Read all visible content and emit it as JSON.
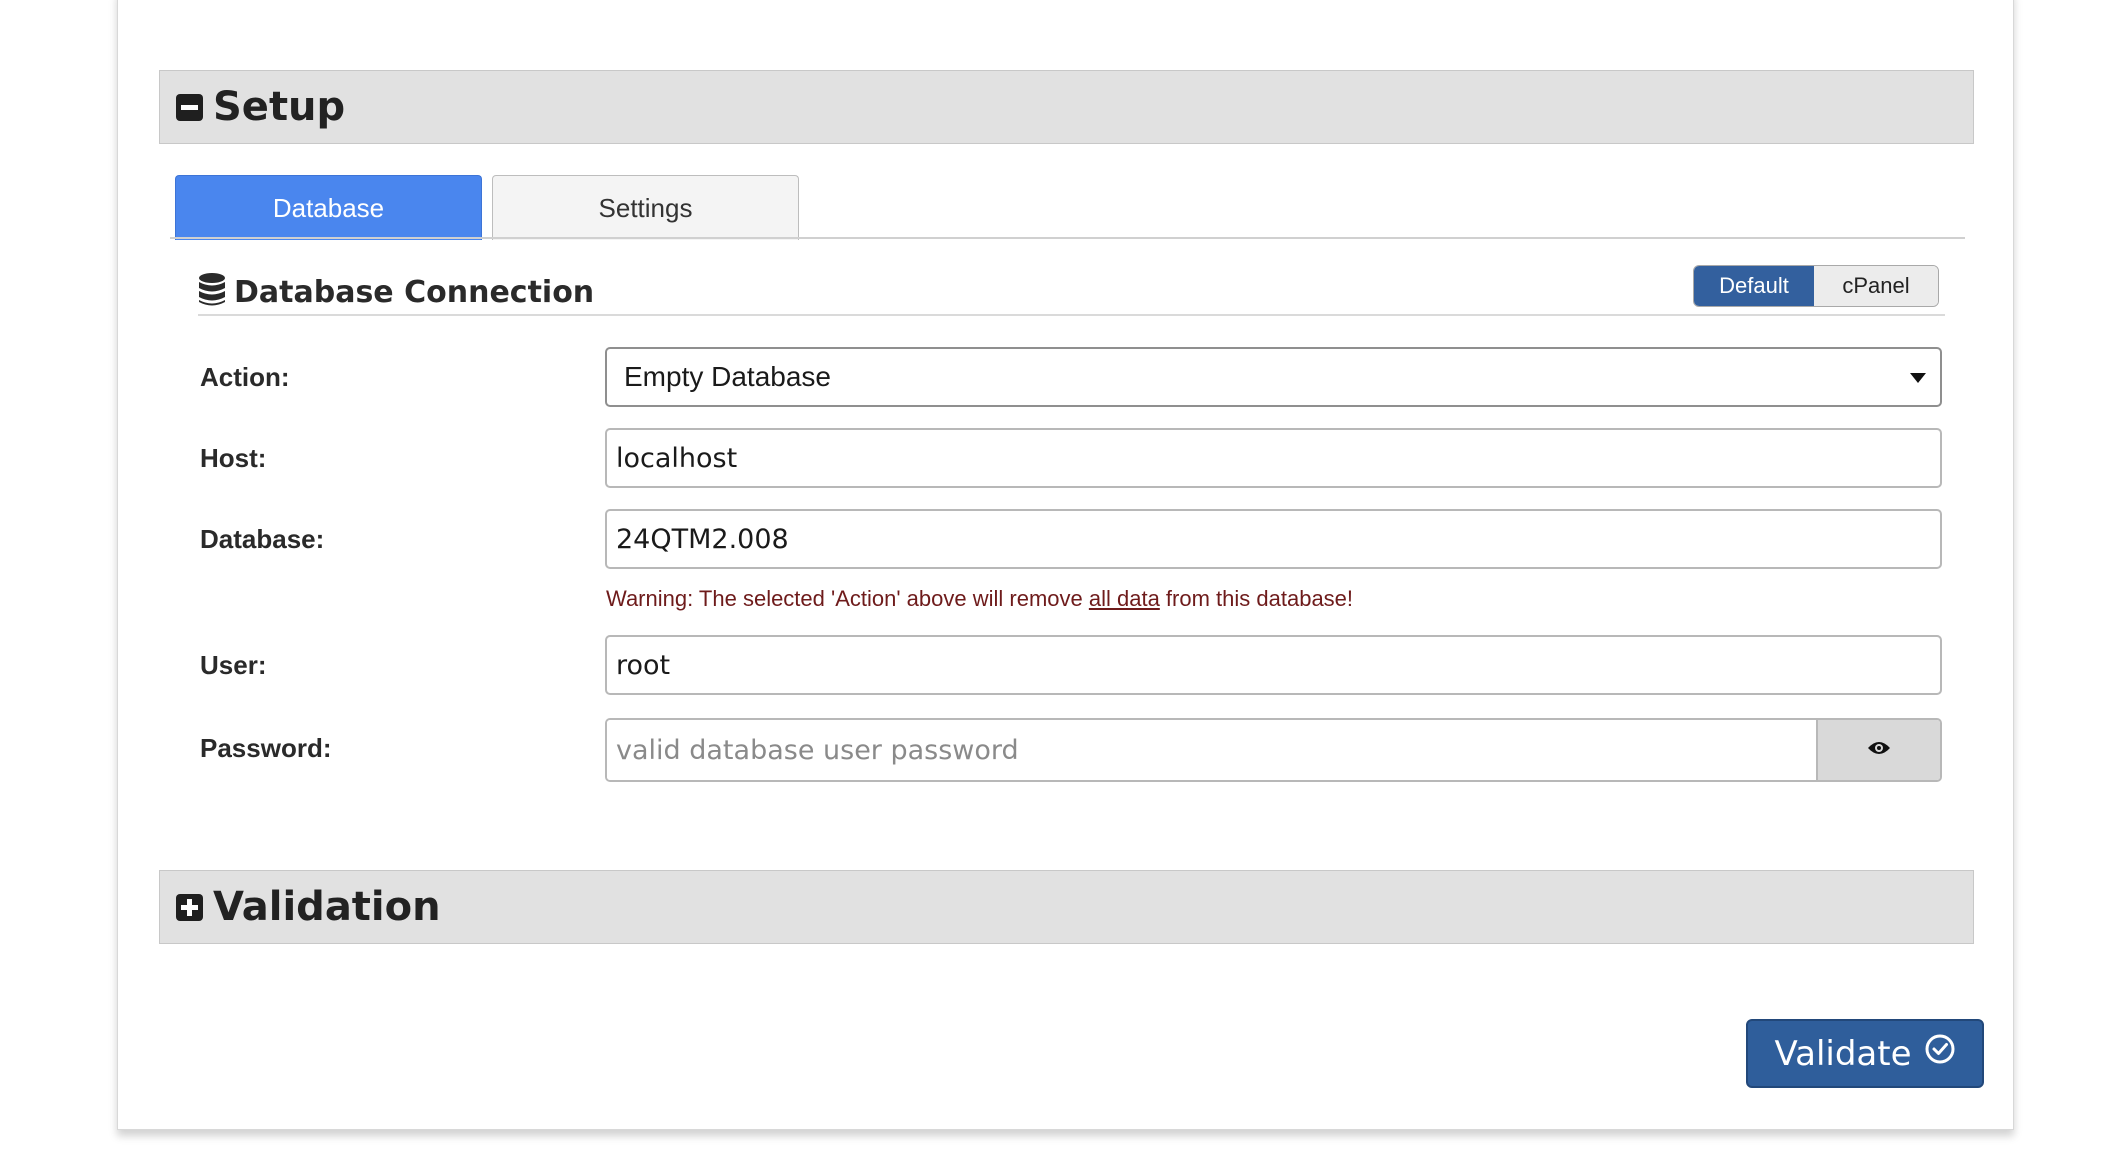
{
  "setup": {
    "title": "Setup"
  },
  "tabs": [
    {
      "label": "Database",
      "active": true
    },
    {
      "label": "Settings",
      "active": false
    }
  ],
  "connection": {
    "title": "Database Connection",
    "toggle": {
      "default_label": "Default",
      "cpanel_label": "cPanel",
      "selected": "Default"
    }
  },
  "form": {
    "action": {
      "label": "Action:",
      "value": "Empty Database"
    },
    "host": {
      "label": "Host:",
      "value": "localhost"
    },
    "database": {
      "label": "Database:",
      "value": "24QTM2.008"
    },
    "warning": {
      "prefix": "Warning: The selected 'Action' above will remove ",
      "link": "all data",
      "suffix": " from this database!"
    },
    "user": {
      "label": "User:",
      "value": "root"
    },
    "password": {
      "label": "Password:",
      "value": "",
      "placeholder": "valid database user password"
    }
  },
  "validation": {
    "title": "Validation"
  },
  "validate_button": {
    "label": "Validate"
  },
  "colors": {
    "tab_active": "#4a86ee",
    "toggle_on": "#33609e",
    "validate_button": "#2f5e9b",
    "warning_text": "#6e1b1b",
    "section_bar": "#e1e1e1"
  },
  "icons": {
    "setup": "minus-square-icon",
    "validation": "plus-square-icon",
    "connection": "database-icon",
    "password_toggle": "eye-icon",
    "validate": "check-circle-icon"
  }
}
